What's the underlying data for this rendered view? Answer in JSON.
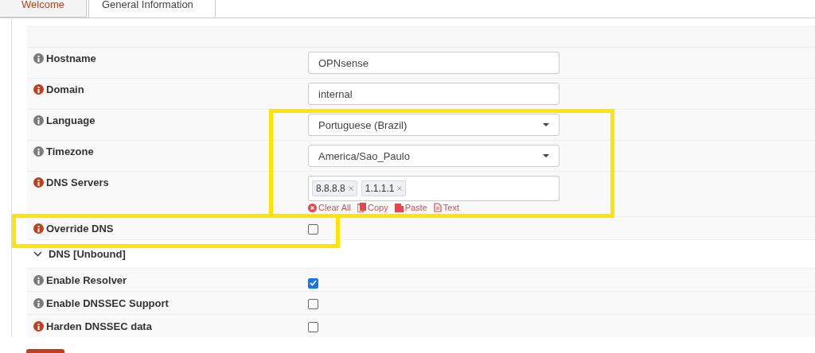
{
  "tabs": [
    {
      "label": "Welcome",
      "selected": false
    },
    {
      "label": "General Information",
      "selected": true
    }
  ],
  "form": [
    {
      "kind": "header"
    },
    {
      "kind": "text",
      "label": "Hostname",
      "color": "#7b7b7b",
      "value": "OPNsense"
    },
    {
      "kind": "text",
      "label": "Domain",
      "color": "#c0401e",
      "value": "internal"
    },
    {
      "kind": "select",
      "label": "Language",
      "color": "#7b7b7b",
      "value": "Portuguese (Brazil)"
    },
    {
      "kind": "select",
      "label": "Timezone",
      "color": "#7b7b7b",
      "value": "America/Sao_Paulo"
    },
    {
      "kind": "tags",
      "label": "DNS Servers",
      "color": "#c0401e",
      "tags": [
        "8.8.8.8",
        "1.1.1.1"
      ],
      "links": [
        {
          "kind": "clear",
          "label": "Clear All"
        },
        {
          "kind": "copy",
          "label": "Copy"
        },
        {
          "kind": "paste",
          "label": "Paste"
        },
        {
          "kind": "text",
          "label": "Text"
        }
      ]
    },
    {
      "kind": "checkbox",
      "label": "Override DNS",
      "color": "#c0401e",
      "checked": false
    },
    {
      "kind": "section",
      "label": "DNS [Unbound]",
      "expanded": true
    },
    {
      "kind": "checkbox",
      "label": "Enable Resolver",
      "color": "#7b7b7b",
      "checked": true
    },
    {
      "kind": "checkbox",
      "label": "Enable DNSSEC Support",
      "color": "#7b7b7b",
      "checked": false
    },
    {
      "kind": "checkbox",
      "label": "Harden DNSSEC data",
      "color": "#c0401e",
      "checked": false
    }
  ]
}
